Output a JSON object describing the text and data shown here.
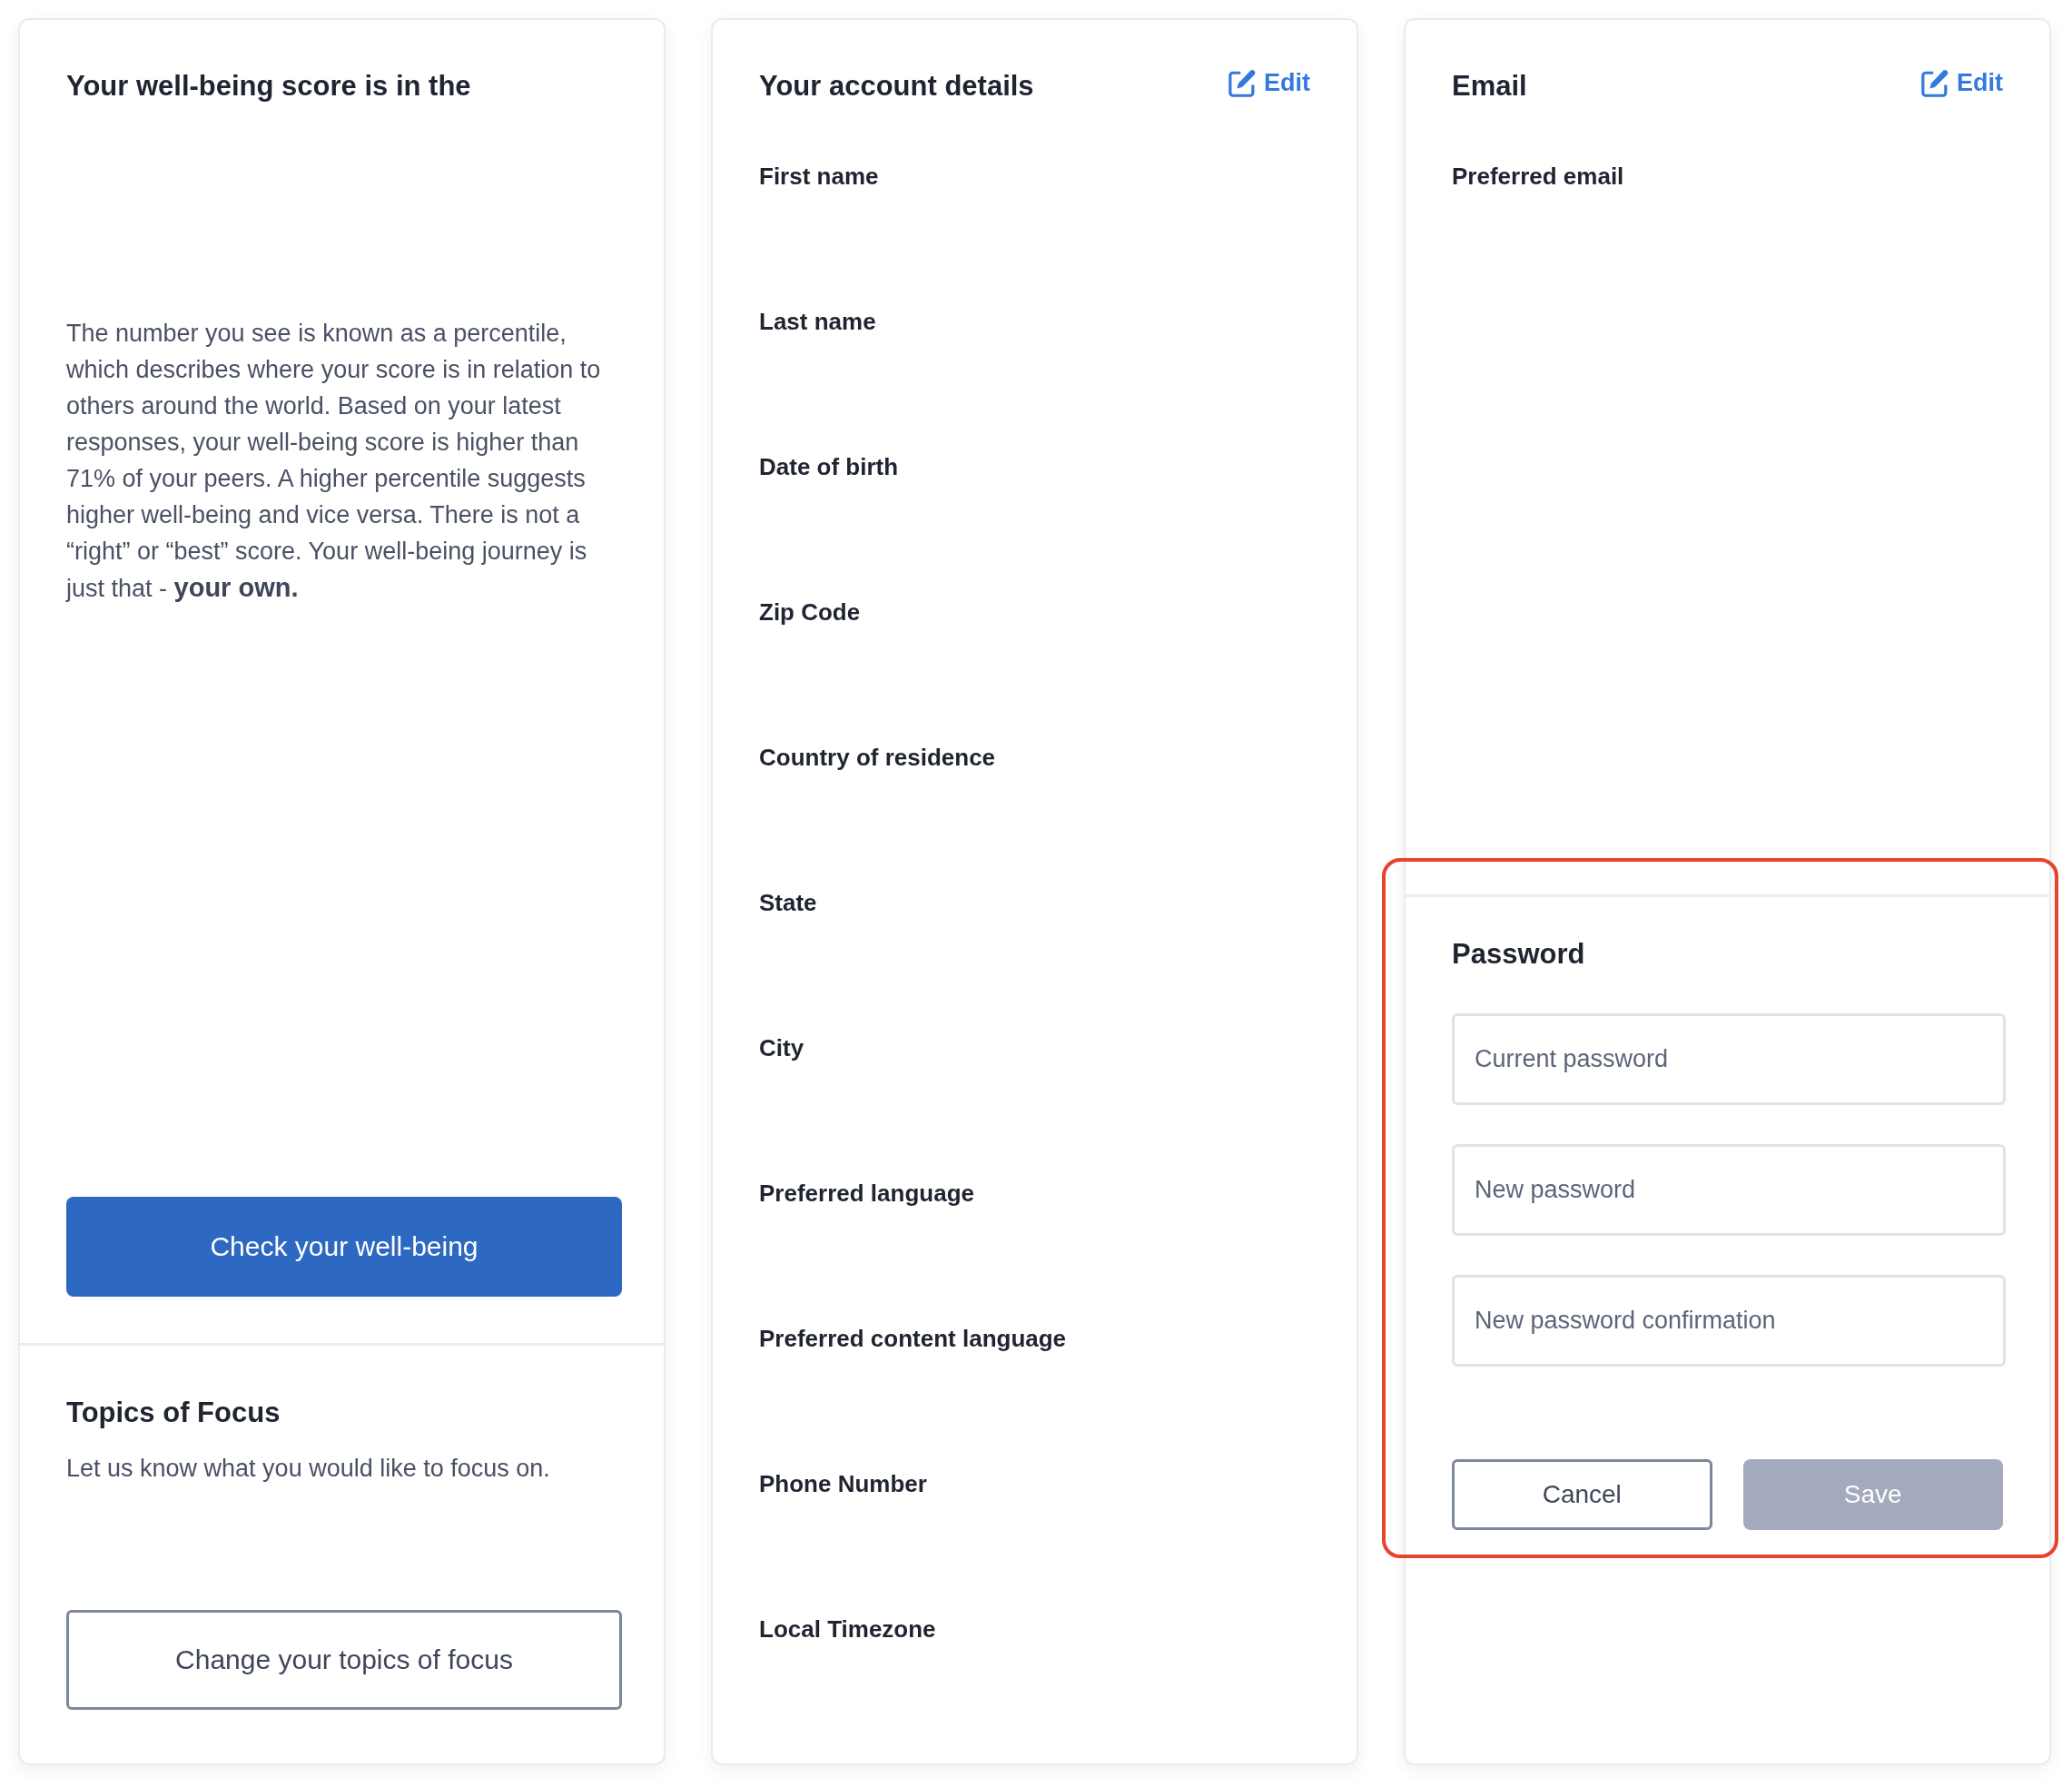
{
  "wellbeing_card": {
    "title": "Your well-being score is in the",
    "description": "The number you see is known as a percentile, which describes where your score is in relation to others around the world. Based on your latest responses, your well-being score is higher than 71% of your peers. A higher percentile suggests higher well-being and vice versa. There is not a “right” or “best” score. Your well-being journey is just that - **your own.**",
    "button": {
      "label": "Check your well-being",
      "kind": "primary"
    }
  },
  "topics_card": {
    "title": "Topics of Focus",
    "description": "Let us know what you would like to focus on.",
    "button": {
      "label": "Change your topics of focus",
      "kind": "outline"
    }
  },
  "account_card": {
    "title": "Your account details",
    "edit_link": "Edit",
    "fields": [
      {
        "label": "First name"
      },
      {
        "label": "Last name"
      },
      {
        "label": "Date of birth"
      },
      {
        "label": "Zip Code"
      },
      {
        "label": "Country of residence"
      },
      {
        "label": "State"
      },
      {
        "label": "City"
      },
      {
        "label": "Preferred language"
      },
      {
        "label": "Preferred content language"
      },
      {
        "label": "Phone Number"
      },
      {
        "label": "Local Timezone"
      }
    ]
  },
  "email_card": {
    "title": "Email",
    "edit_link": "Edit",
    "fields": [
      {
        "label": "Preferred email"
      }
    ]
  },
  "password_card": {
    "title": "Password",
    "highlighted": true,
    "inputs": [
      {
        "placeholder": "Current password"
      },
      {
        "placeholder": "New password"
      },
      {
        "placeholder": "New password confirmation"
      }
    ],
    "buttons": [
      {
        "label": "Cancel",
        "kind": "outline",
        "disabled": false
      },
      {
        "label": "Save",
        "kind": "primary",
        "disabled": true
      }
    ]
  }
}
